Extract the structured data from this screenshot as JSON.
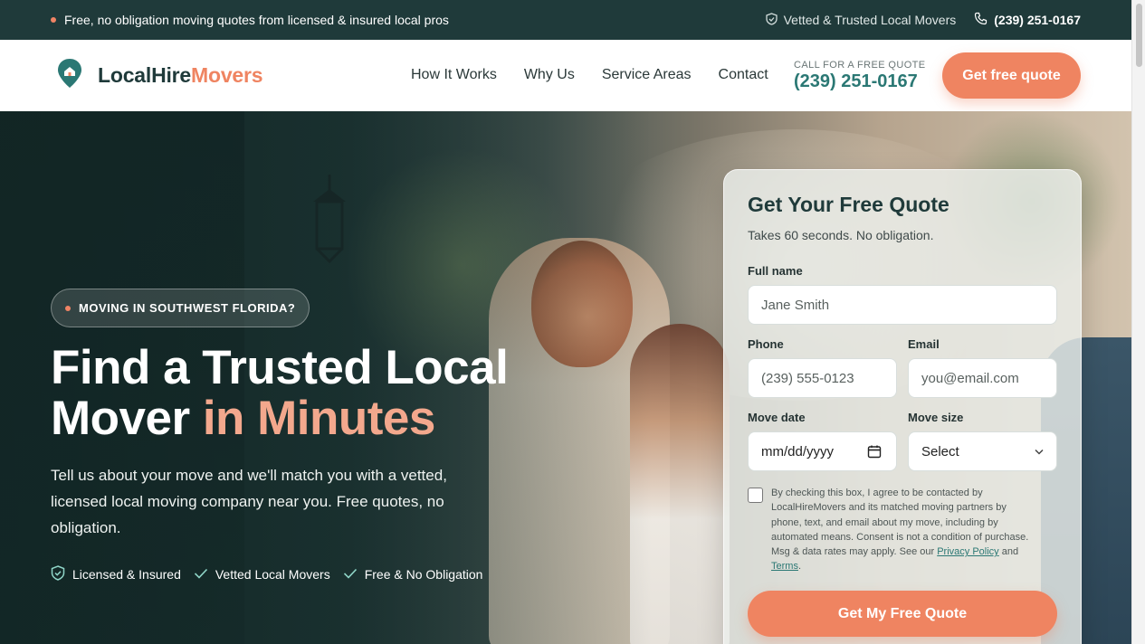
{
  "topbar": {
    "message": "Free, no obligation moving quotes from licensed & insured local pros",
    "vetted": "Vetted & Trusted Local Movers",
    "phone": "(239) 251-0167"
  },
  "header": {
    "logo_main": "LocalHire",
    "logo_accent": "Movers",
    "nav": [
      "How It Works",
      "Why Us",
      "Service Areas",
      "Contact"
    ],
    "call_label": "CALL FOR A FREE QUOTE",
    "call_number": "(239) 251-0167",
    "cta": "Get free quote"
  },
  "hero": {
    "pill": "MOVING IN SOUTHWEST FLORIDA?",
    "title_line1": "Find a Trusted Local",
    "title_line2_plain": "Mover ",
    "title_line2_accent": "in Minutes",
    "subtitle": "Tell us about your move and we'll match you with a vetted, licensed local moving company near you. Free quotes, no obligation.",
    "features": [
      "Licensed & Insured",
      "Vetted Local Movers",
      "Free & No Obligation"
    ]
  },
  "form": {
    "title": "Get Your Free Quote",
    "subtitle": "Takes 60 seconds. No obligation.",
    "fullname_label": "Full name",
    "fullname_placeholder": "Jane Smith",
    "phone_label": "Phone",
    "phone_placeholder": "(239) 555-0123",
    "email_label": "Email",
    "email_placeholder": "you@email.com",
    "date_label": "Move date",
    "date_placeholder": "mm/dd/yyyy",
    "size_label": "Move size",
    "size_value": "Select",
    "consent_text": "By checking this box, I agree to be contacted by LocalHireMovers and its matched moving partners by phone, text, and email about my move, including by automated means. Consent is not a condition of purchase. Msg & data rates may apply. See our ",
    "privacy": "Privacy Policy",
    "and": " and ",
    "terms": "Terms",
    "period": ".",
    "submit": "Get My Free Quote"
  },
  "colors": {
    "brand_dark": "#1f3a3a",
    "accent": "#ef8461",
    "teal": "#2b7874"
  }
}
